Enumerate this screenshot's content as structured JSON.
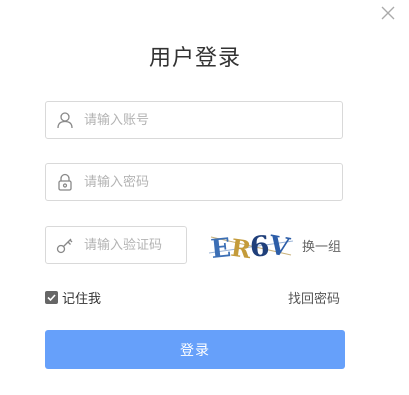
{
  "dialog": {
    "title": "用户登录",
    "close_icon": "close-icon"
  },
  "account": {
    "icon": "user-icon",
    "placeholder": "请输入账号",
    "value": ""
  },
  "password": {
    "icon": "lock-icon",
    "placeholder": "请输入密码",
    "value": ""
  },
  "captcha": {
    "icon": "key-icon",
    "placeholder": "请输入验证码",
    "value": "",
    "image_text": "ER6V",
    "refresh_label": "换一组"
  },
  "remember": {
    "label": "记住我",
    "checked": true
  },
  "forgot_label": "找回密码",
  "login_label": "登录",
  "colors": {
    "primary_button": "#66a0fa",
    "border": "#d9d9d9",
    "placeholder": "#b3b3b3",
    "title": "#333333"
  }
}
